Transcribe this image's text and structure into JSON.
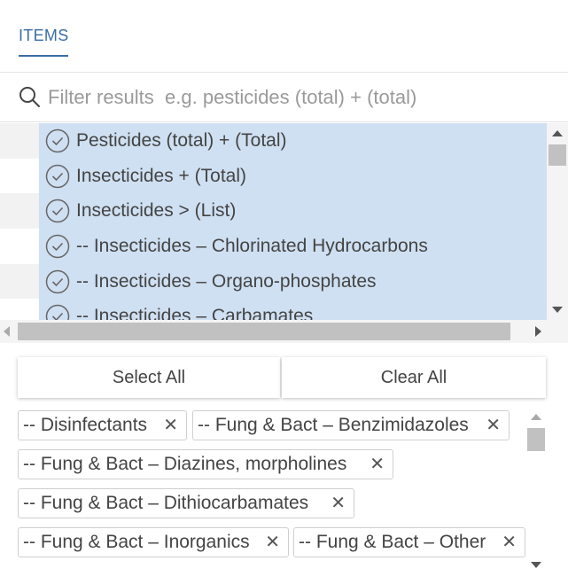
{
  "tabs": [
    {
      "label": "ITEMS",
      "active": true
    }
  ],
  "filter": {
    "placeholder": "Filter results  e.g. pesticides (total) + (total)",
    "value": ""
  },
  "list": {
    "items": [
      {
        "label": "Pesticides (total) + (Total)",
        "selected": true
      },
      {
        "label": "Insecticides + (Total)",
        "selected": true
      },
      {
        "label": "Insecticides > (List)",
        "selected": true
      },
      {
        "label": "-- Insecticides – Chlorinated Hydrocarbons",
        "selected": true
      },
      {
        "label": "-- Insecticides – Organo-phosphates",
        "selected": true
      },
      {
        "label": "-- Insecticides – Carbamates",
        "selected": true
      }
    ]
  },
  "actions": {
    "select_all": "Select All",
    "clear_all": "Clear All"
  },
  "selected_chips": [
    {
      "label": "-- Disinfectants"
    },
    {
      "label": "-- Fung & Bact – Benzimidazoles"
    },
    {
      "label": "-- Fung & Bact – Diazines, morpholines"
    },
    {
      "label": "-- Fung & Bact – Dithiocarbamates"
    },
    {
      "label": "-- Fung & Bact – Inorganics"
    },
    {
      "label": "-- Fung & Bact – Other"
    }
  ],
  "icons": {
    "search": "search-icon",
    "check": "check-circle-icon",
    "remove": "close-icon"
  },
  "colors": {
    "accent": "#3a6ea5",
    "selection": "#cfe0f2"
  }
}
